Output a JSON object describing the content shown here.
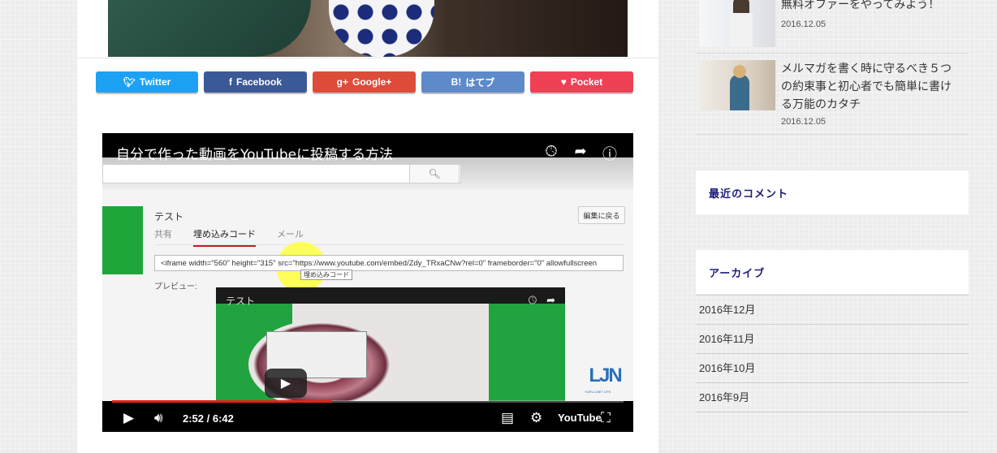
{
  "share_buttons": [
    {
      "label": "Twitter",
      "icon": "twitter-bird",
      "color": "#1da1f2"
    },
    {
      "label": "Facebook",
      "icon": "f",
      "color": "#3b5998"
    },
    {
      "label": "Google+",
      "icon": "g+",
      "color": "#dd4b39"
    },
    {
      "label": "はてブ",
      "icon": "B!",
      "color": "#5d8ac9"
    },
    {
      "label": "Pocket",
      "icon": "pocket-heart",
      "color": "#ef4056"
    }
  ],
  "video": {
    "title": "自分で作った動画をYouTubeに投稿する方法",
    "time": "2:52 / 6:42",
    "progress": 0.43,
    "inner_panel": {
      "name": "テスト",
      "back_button": "編集に戻る",
      "tabs": [
        "共有",
        "埋め込みコード",
        "メール"
      ],
      "embed_code": "<iframe width=\"560\" height=\"315\" src=\"https://www.youtube.com/embed/Zdy_TRxaCNw?rel=0\" frameborder=\"0\" allowfullscreen",
      "tooltip": "埋め込みコード",
      "preview_label": "プレビュー:",
      "inner_title": "テスト"
    },
    "logo_text": "LJN",
    "logo_sub": "YURU-LNET LIFE",
    "youtube_label": "YouTube"
  },
  "sidebar": {
    "posts": [
      {
        "title": "無料オファーをやってみよう！",
        "date": "2016.12.05"
      },
      {
        "title": "メルマガを書く時に守るべき５つの約束事と初心者でも簡単に書ける万能のカタチ",
        "date": "2016.12.05"
      }
    ],
    "recent_comments_title": "最近のコメント",
    "archive_title": "アーカイブ",
    "archives": [
      "2016年12月",
      "2016年11月",
      "2016年10月",
      "2016年9月"
    ]
  }
}
